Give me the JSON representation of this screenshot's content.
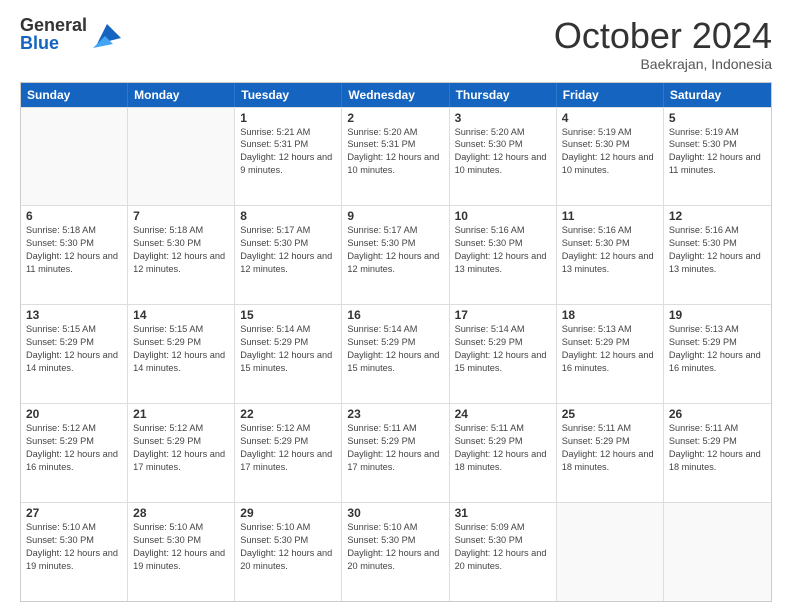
{
  "logo": {
    "general": "General",
    "blue": "Blue"
  },
  "title": "October 2024",
  "location": "Baekrajan, Indonesia",
  "days_header": [
    "Sunday",
    "Monday",
    "Tuesday",
    "Wednesday",
    "Thursday",
    "Friday",
    "Saturday"
  ],
  "weeks": [
    [
      {
        "day": "",
        "sunrise": "",
        "sunset": "",
        "daylight": ""
      },
      {
        "day": "",
        "sunrise": "",
        "sunset": "",
        "daylight": ""
      },
      {
        "day": "1",
        "sunrise": "Sunrise: 5:21 AM",
        "sunset": "Sunset: 5:31 PM",
        "daylight": "Daylight: 12 hours and 9 minutes."
      },
      {
        "day": "2",
        "sunrise": "Sunrise: 5:20 AM",
        "sunset": "Sunset: 5:31 PM",
        "daylight": "Daylight: 12 hours and 10 minutes."
      },
      {
        "day": "3",
        "sunrise": "Sunrise: 5:20 AM",
        "sunset": "Sunset: 5:30 PM",
        "daylight": "Daylight: 12 hours and 10 minutes."
      },
      {
        "day": "4",
        "sunrise": "Sunrise: 5:19 AM",
        "sunset": "Sunset: 5:30 PM",
        "daylight": "Daylight: 12 hours and 10 minutes."
      },
      {
        "day": "5",
        "sunrise": "Sunrise: 5:19 AM",
        "sunset": "Sunset: 5:30 PM",
        "daylight": "Daylight: 12 hours and 11 minutes."
      }
    ],
    [
      {
        "day": "6",
        "sunrise": "Sunrise: 5:18 AM",
        "sunset": "Sunset: 5:30 PM",
        "daylight": "Daylight: 12 hours and 11 minutes."
      },
      {
        "day": "7",
        "sunrise": "Sunrise: 5:18 AM",
        "sunset": "Sunset: 5:30 PM",
        "daylight": "Daylight: 12 hours and 12 minutes."
      },
      {
        "day": "8",
        "sunrise": "Sunrise: 5:17 AM",
        "sunset": "Sunset: 5:30 PM",
        "daylight": "Daylight: 12 hours and 12 minutes."
      },
      {
        "day": "9",
        "sunrise": "Sunrise: 5:17 AM",
        "sunset": "Sunset: 5:30 PM",
        "daylight": "Daylight: 12 hours and 12 minutes."
      },
      {
        "day": "10",
        "sunrise": "Sunrise: 5:16 AM",
        "sunset": "Sunset: 5:30 PM",
        "daylight": "Daylight: 12 hours and 13 minutes."
      },
      {
        "day": "11",
        "sunrise": "Sunrise: 5:16 AM",
        "sunset": "Sunset: 5:30 PM",
        "daylight": "Daylight: 12 hours and 13 minutes."
      },
      {
        "day": "12",
        "sunrise": "Sunrise: 5:16 AM",
        "sunset": "Sunset: 5:30 PM",
        "daylight": "Daylight: 12 hours and 13 minutes."
      }
    ],
    [
      {
        "day": "13",
        "sunrise": "Sunrise: 5:15 AM",
        "sunset": "Sunset: 5:29 PM",
        "daylight": "Daylight: 12 hours and 14 minutes."
      },
      {
        "day": "14",
        "sunrise": "Sunrise: 5:15 AM",
        "sunset": "Sunset: 5:29 PM",
        "daylight": "Daylight: 12 hours and 14 minutes."
      },
      {
        "day": "15",
        "sunrise": "Sunrise: 5:14 AM",
        "sunset": "Sunset: 5:29 PM",
        "daylight": "Daylight: 12 hours and 15 minutes."
      },
      {
        "day": "16",
        "sunrise": "Sunrise: 5:14 AM",
        "sunset": "Sunset: 5:29 PM",
        "daylight": "Daylight: 12 hours and 15 minutes."
      },
      {
        "day": "17",
        "sunrise": "Sunrise: 5:14 AM",
        "sunset": "Sunset: 5:29 PM",
        "daylight": "Daylight: 12 hours and 15 minutes."
      },
      {
        "day": "18",
        "sunrise": "Sunrise: 5:13 AM",
        "sunset": "Sunset: 5:29 PM",
        "daylight": "Daylight: 12 hours and 16 minutes."
      },
      {
        "day": "19",
        "sunrise": "Sunrise: 5:13 AM",
        "sunset": "Sunset: 5:29 PM",
        "daylight": "Daylight: 12 hours and 16 minutes."
      }
    ],
    [
      {
        "day": "20",
        "sunrise": "Sunrise: 5:12 AM",
        "sunset": "Sunset: 5:29 PM",
        "daylight": "Daylight: 12 hours and 16 minutes."
      },
      {
        "day": "21",
        "sunrise": "Sunrise: 5:12 AM",
        "sunset": "Sunset: 5:29 PM",
        "daylight": "Daylight: 12 hours and 17 minutes."
      },
      {
        "day": "22",
        "sunrise": "Sunrise: 5:12 AM",
        "sunset": "Sunset: 5:29 PM",
        "daylight": "Daylight: 12 hours and 17 minutes."
      },
      {
        "day": "23",
        "sunrise": "Sunrise: 5:11 AM",
        "sunset": "Sunset: 5:29 PM",
        "daylight": "Daylight: 12 hours and 17 minutes."
      },
      {
        "day": "24",
        "sunrise": "Sunrise: 5:11 AM",
        "sunset": "Sunset: 5:29 PM",
        "daylight": "Daylight: 12 hours and 18 minutes."
      },
      {
        "day": "25",
        "sunrise": "Sunrise: 5:11 AM",
        "sunset": "Sunset: 5:29 PM",
        "daylight": "Daylight: 12 hours and 18 minutes."
      },
      {
        "day": "26",
        "sunrise": "Sunrise: 5:11 AM",
        "sunset": "Sunset: 5:29 PM",
        "daylight": "Daylight: 12 hours and 18 minutes."
      }
    ],
    [
      {
        "day": "27",
        "sunrise": "Sunrise: 5:10 AM",
        "sunset": "Sunset: 5:30 PM",
        "daylight": "Daylight: 12 hours and 19 minutes."
      },
      {
        "day": "28",
        "sunrise": "Sunrise: 5:10 AM",
        "sunset": "Sunset: 5:30 PM",
        "daylight": "Daylight: 12 hours and 19 minutes."
      },
      {
        "day": "29",
        "sunrise": "Sunrise: 5:10 AM",
        "sunset": "Sunset: 5:30 PM",
        "daylight": "Daylight: 12 hours and 20 minutes."
      },
      {
        "day": "30",
        "sunrise": "Sunrise: 5:10 AM",
        "sunset": "Sunset: 5:30 PM",
        "daylight": "Daylight: 12 hours and 20 minutes."
      },
      {
        "day": "31",
        "sunrise": "Sunrise: 5:09 AM",
        "sunset": "Sunset: 5:30 PM",
        "daylight": "Daylight: 12 hours and 20 minutes."
      },
      {
        "day": "",
        "sunrise": "",
        "sunset": "",
        "daylight": ""
      },
      {
        "day": "",
        "sunrise": "",
        "sunset": "",
        "daylight": ""
      }
    ]
  ]
}
